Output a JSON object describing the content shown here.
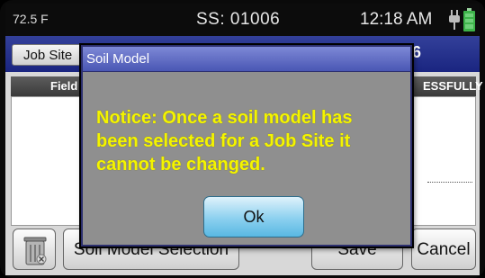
{
  "status_bar": {
    "temperature": "72.5 F",
    "serial": "SS: 01006",
    "time": "12:18 AM",
    "plug_icon": "power-plug-icon",
    "battery_icon": "battery-icon",
    "battery_color": "#3db34a"
  },
  "screen": {
    "tab_label": "Job Site",
    "title_right_fragment": "6",
    "table": {
      "header_left": "Field",
      "header_right": "ESSFULLY"
    },
    "buttons": {
      "trash_icon": "trash-can-icon",
      "soil_model_selection": "Soil Model Selection",
      "save": "Save",
      "cancel": "Cancel"
    }
  },
  "dialog": {
    "title": "Soil Model",
    "message": "Notice:  Once a soil model has been selected for a Job Site it cannot be changed.",
    "ok_label": "Ok"
  },
  "colors": {
    "title_bar": "#1a2580",
    "dialog_header": "#5f6bc4",
    "message_text": "#f4f400",
    "ok_button": "#8bd0ef"
  }
}
